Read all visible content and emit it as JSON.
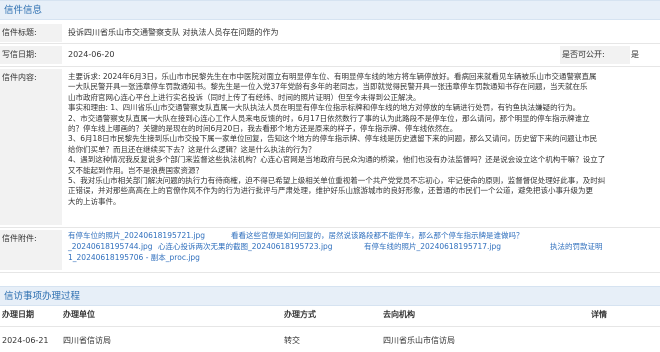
{
  "section1": {
    "title": "信件信息"
  },
  "letter": {
    "title_label": "信件标题:",
    "title_value": "投诉四川省乐山市交通警察支队 对执法人员存在问题的作为",
    "date_label": "写信日期:",
    "date_value": "2024-06-20",
    "public_label": "是否可公开:",
    "public_value": "是",
    "content_label": "信件内容:",
    "content_lines": [
      "主要诉求: 2024年6月3日，乐山市市民黎先生在市中医院对面立有明显停车位、有明显停车线的地方将车辆停放好。看病回来就看见车辆被乐山市交通警察直属",
      "一大队民警开具一张违章停车罚款通知书。黎先生是一位入党37年党龄有多年的老同志，当即就觉得民警开具一张违章停车罚款通知书存在问题，当天就在乐",
      "山市政府官网心连心平台上进行实名投诉（同时上传了有经纬、时间的照片证明）但至今未得到公正解决。",
      "事实和理由: 1、四川省乐山市交通警察支队直属一大队执法人员在明显有停车位指示标牌和停车线的地方对停放的车辆进行处罚，有钓鱼执法嫌疑的行为。",
      "2、市交通警察支队直属一大队在接到心连心工作人员来电反馈的时，6月17日依然数行了事的认为此路段不是停车位，那么请问，那个明显的停车指示牌谁立",
      "的？停车线上哪画的？关键的是现在的时间6月20日，我去看那个地方还是原来的样子，停车指示牌、停车线依然在。",
      "3、6月18日市民黎先生接到乐山市交投下属一家单位回复，告知这个地方的停车指示牌、停车线是历史遗留下来的问题，那么又请问，历史留下来的问题让市民",
      "给你们买单？而且还在继续买下去？这是什么逻辑？这是什么执法的行为？",
      "4、遇到这种情况我反复说多个部门来监督这些执法机构？心连心官网是当地政府与民众沟通的桥梁，他们也没有办法监督吗？还是说会设立这个机构干嘛？设立了",
      "又不能起到作用。岂不是浪费国家资源？",
      "5、我对乐山市相关部门解决问题的执行力有待商榷，迫不得已希望上级相关单位重视着一个共产党党员不忘初心，牢记使命的原则，监督督促处理好此事，及时纠",
      "正错误，并对那些高高在上的官僚作风不作为的行为进行批评与严肃处理，维护好乐山旅游城市的良好形象，还普通的市民们一个公道，避免把该小事升级为更",
      "大的上访事件。"
    ],
    "attachments_label": "信件附件:",
    "attachments": [
      [
        "有停车位的照片_20240618195721.jpg",
        "看看这些官僚是如何回复的，居然说该路段都不能停车，那么那个停车指示牌是谁做吗？"
      ],
      [
        "_20240618195744.jpg",
        "心连心投诉两次无果的截图_20240618195723.jpg",
        "有停车线的照片_20240618195717.jpg",
        "执法的罚款证明"
      ],
      [
        "1_20240618195706 - 副本_proc.jpg"
      ]
    ]
  },
  "section2": {
    "title": "信访事项办理过程",
    "headers": [
      "办理日期",
      "办理单位",
      "办理方式",
      "去向机构",
      "详情"
    ],
    "row": [
      "2024-06-21",
      "四川省信访局",
      "转交",
      "四川省乐山市信访局",
      ""
    ]
  }
}
